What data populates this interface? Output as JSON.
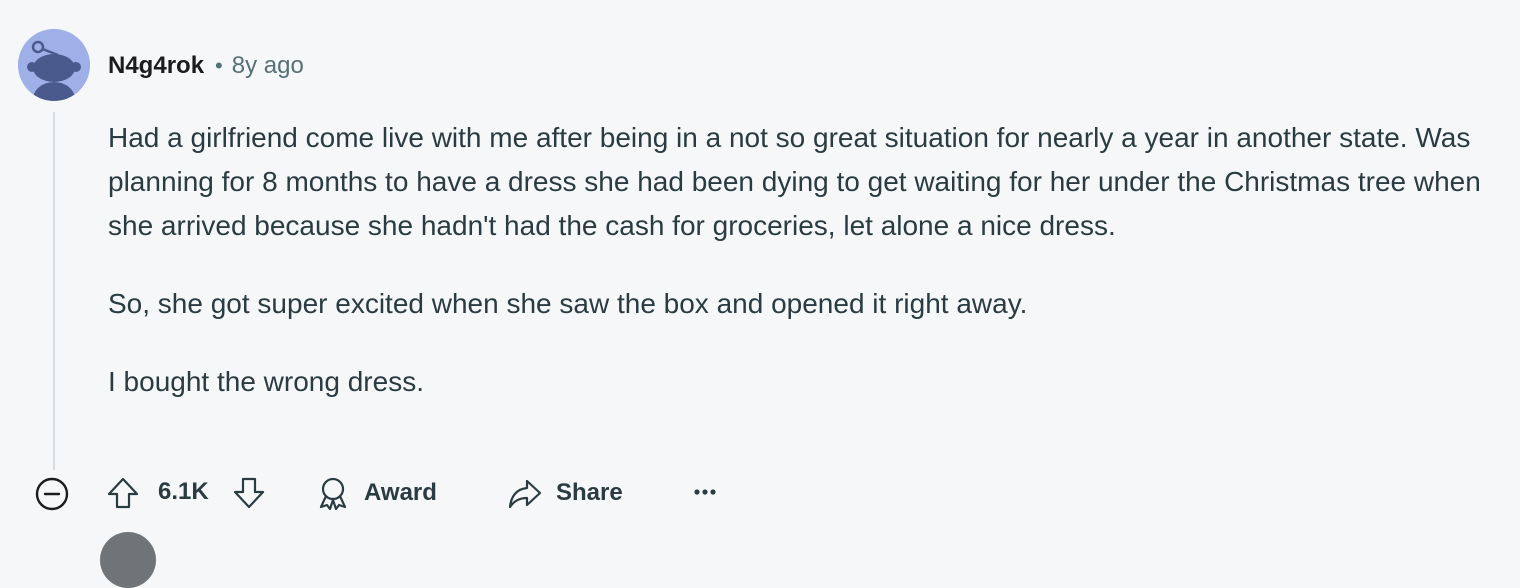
{
  "comment": {
    "username": "N4g4rok",
    "separator": "•",
    "timestamp": "8y ago",
    "paragraphs": [
      "Had a girlfriend come live with me after being in a not so great situation for nearly a year in another state. Was planning for 8 months to have a dress she had been dying to get waiting for her under the Christmas tree when she arrived because she hadn't had the cash for groceries, let alone a nice dress.",
      "So, she got super excited when she saw the box and opened it right away.",
      "I bought the wrong dress."
    ]
  },
  "actions": {
    "score": "6.1K",
    "award_label": "Award",
    "share_label": "Share"
  },
  "icons": {
    "avatar": "snoo-avatar-icon",
    "collapse": "collapse-minus-icon",
    "upvote": "upvote-arrow-icon",
    "downvote": "downvote-arrow-icon",
    "award": "award-ribbon-icon",
    "share": "share-arrow-icon",
    "more": "more-options-icon"
  },
  "colors": {
    "background": "#f6f7f9",
    "avatar_bg": "#9fb0e8",
    "avatar_fg": "#4a5a8c",
    "meta_text": "#576f76",
    "body_text": "#2a3c42",
    "thread_line": "#d5dde2"
  }
}
